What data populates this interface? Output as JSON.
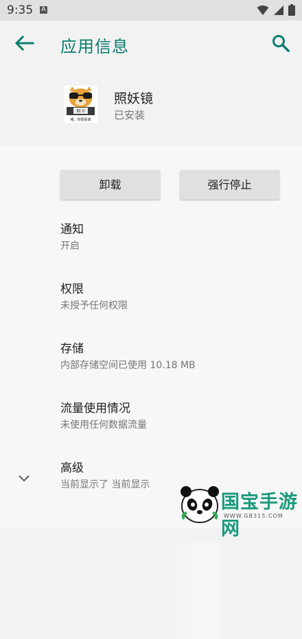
{
  "status_bar": {
    "time": "9:35",
    "notification": "A"
  },
  "app_bar": {
    "title": "应用信息"
  },
  "app": {
    "name": "照妖镜",
    "status": "已安装",
    "icon_caption": "喵，你很看谁"
  },
  "buttons": {
    "uninstall": "卸载",
    "force_stop": "强行停止"
  },
  "settings": [
    {
      "title": "通知",
      "summary": "开启"
    },
    {
      "title": "权限",
      "summary": "未授予任何权限"
    },
    {
      "title": "存储",
      "summary": "内部存储空间已使用 10.18 MB"
    },
    {
      "title": "流量使用情况",
      "summary": "未使用任何数据流量"
    },
    {
      "title": "高级",
      "summary": "当前显示了 当前显示"
    }
  ],
  "watermark": {
    "text": "国宝手游网",
    "url": "WWW.GB315.COM"
  },
  "colors": {
    "accent": "#0a7d6e",
    "background": "#f2f2f2",
    "button": "#e0e0e0"
  }
}
